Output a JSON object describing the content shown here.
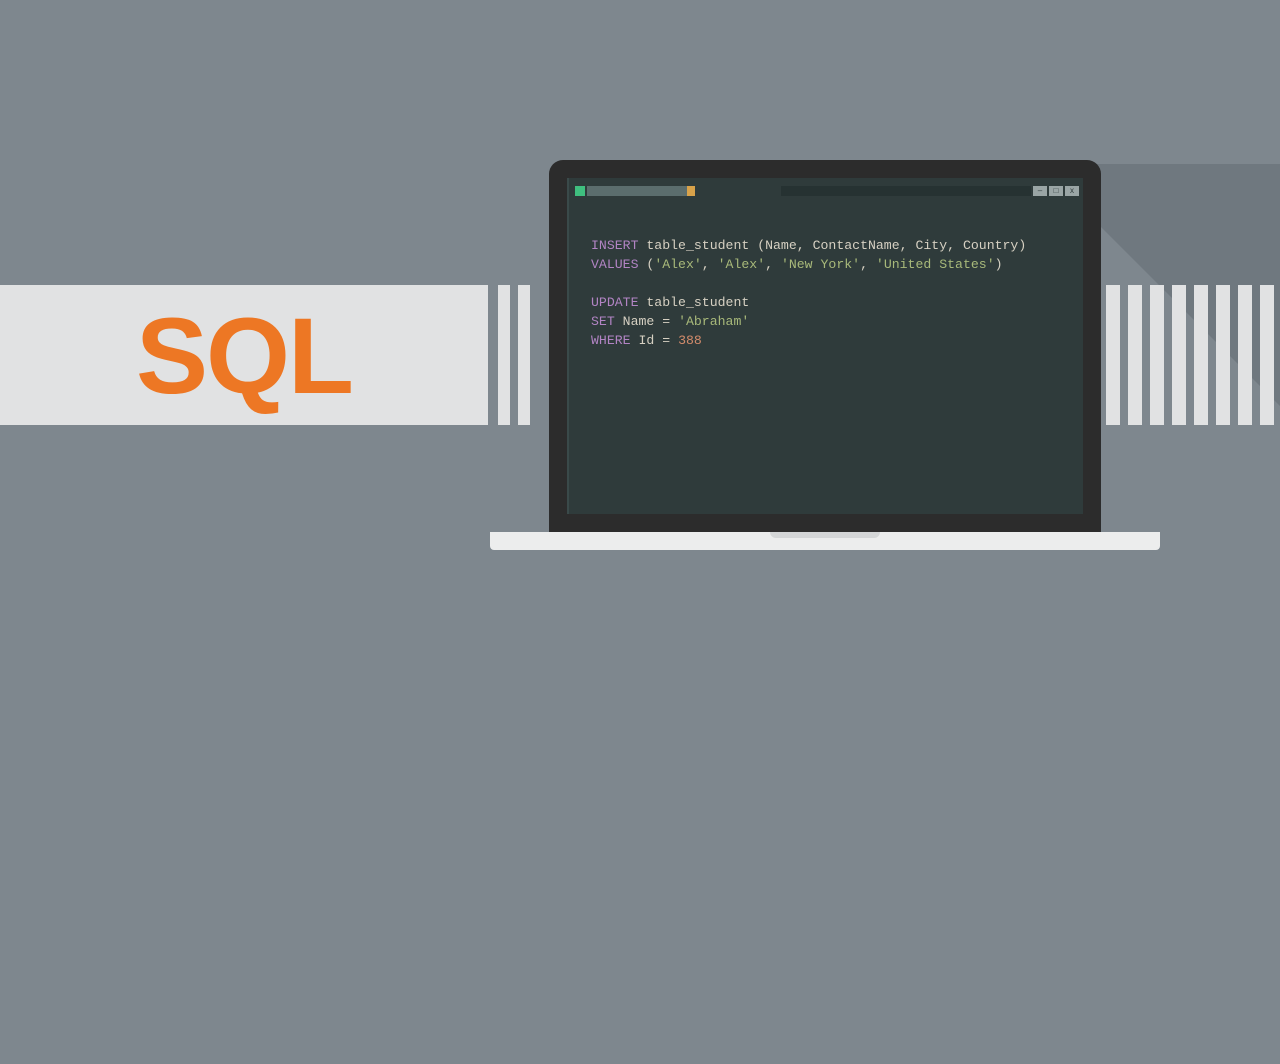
{
  "banner": {
    "label": "SQL"
  },
  "terminal": {
    "window_buttons": {
      "min": "–",
      "max": "□",
      "close": "x"
    },
    "code": {
      "line1": {
        "kw": "INSERT",
        "rest": " table_student (Name, ContactName, City, Country)"
      },
      "line2": {
        "kw": "VALUES",
        "sp": " (",
        "s1": "'Alex'",
        "c1": ", ",
        "s2": "'Alex'",
        "c2": ", ",
        "s3": "'New York'",
        "c3": ", ",
        "s4": "'United States'",
        "rp": ")"
      },
      "line3": "",
      "line4": {
        "kw": "UPDATE",
        "rest": " table_student"
      },
      "line5": {
        "kw": "SET",
        "mid": " Name = ",
        "s1": "'Abraham'"
      },
      "line6": {
        "kw": "WHERE",
        "mid": " Id = ",
        "num": "388"
      }
    }
  },
  "colors": {
    "background": "#7e878e",
    "banner_bg": "#e1e2e3",
    "accent": "#ed7724",
    "bezel": "#2c2c2c",
    "terminal_bg": "#2f3b3b"
  }
}
